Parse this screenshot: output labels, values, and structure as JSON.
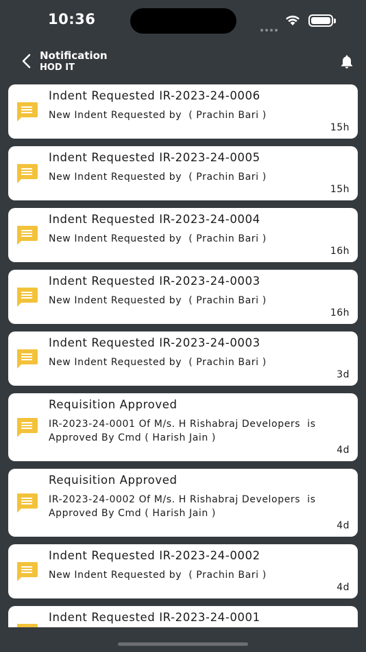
{
  "status_bar": {
    "time": "10:36"
  },
  "header": {
    "title": "Notification",
    "subtitle": "HOD IT"
  },
  "colors": {
    "background": "#353a3e",
    "card": "#ffffff",
    "icon": "#f3c23b"
  },
  "notifications": [
    {
      "title": "Indent Requested IR-2023-24-0006",
      "body": "New Indent Requested by  ( Prachin Bari )",
      "time": "15h",
      "icon": "message-icon"
    },
    {
      "title": "Indent Requested IR-2023-24-0005",
      "body": "New Indent Requested by  ( Prachin Bari )",
      "time": "15h",
      "icon": "message-icon"
    },
    {
      "title": "Indent Requested IR-2023-24-0004",
      "body": "New Indent Requested by  ( Prachin Bari )",
      "time": "16h",
      "icon": "message-icon"
    },
    {
      "title": "Indent Requested IR-2023-24-0003",
      "body": "New Indent Requested by  ( Prachin Bari )",
      "time": "16h",
      "icon": "message-icon"
    },
    {
      "title": "Indent Requested IR-2023-24-0003",
      "body": "New Indent Requested by  ( Prachin Bari )",
      "time": "3d",
      "icon": "message-icon"
    },
    {
      "title": "Requisition Approved",
      "body": "IR-2023-24-0001 Of M/s. H Rishabraj Developers  is Approved By Cmd ( Harish Jain )",
      "time": "4d",
      "icon": "message-icon"
    },
    {
      "title": "Requisition Approved",
      "body": "IR-2023-24-0002 Of M/s. H Rishabraj Developers  is Approved By Cmd ( Harish Jain )",
      "time": "4d",
      "icon": "message-icon"
    },
    {
      "title": "Indent Requested IR-2023-24-0002",
      "body": "New Indent Requested by  ( Prachin Bari )",
      "time": "4d",
      "icon": "message-icon"
    },
    {
      "title": "Indent Requested IR-2023-24-0001",
      "body": "",
      "time": "",
      "icon": "message-icon"
    }
  ]
}
